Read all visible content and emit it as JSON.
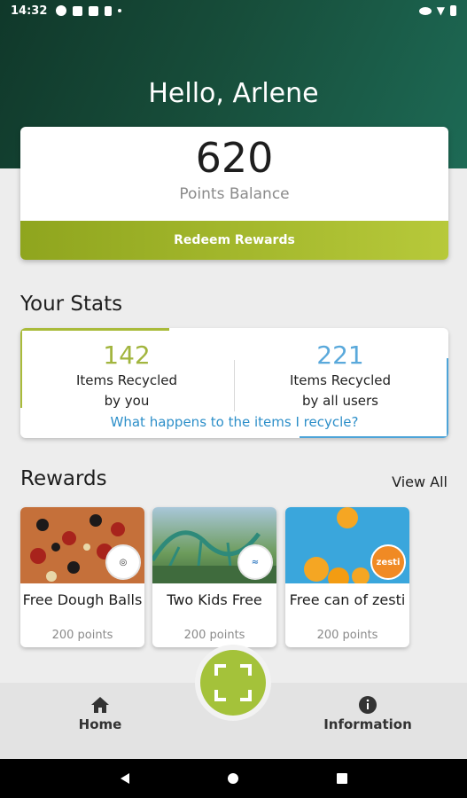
{
  "status_bar": {
    "time": "14:32"
  },
  "header": {
    "greeting": "Hello, Arlene"
  },
  "balance": {
    "points": "620",
    "label": "Points Balance",
    "redeem_label": "Redeem Rewards"
  },
  "stats": {
    "title": "Your Stats",
    "you": {
      "count": "142",
      "label_line1": "Items Recycled",
      "label_line2": "by you"
    },
    "all": {
      "count": "221",
      "label_line1": "Items Recycled",
      "label_line2": "by all users"
    },
    "link": "What happens to the items I recycle?"
  },
  "rewards": {
    "title": "Rewards",
    "view_all": "View All",
    "items": [
      {
        "title": "Free Dough Balls",
        "points": "200 points"
      },
      {
        "title": "Two Kids Free",
        "points": "200 points"
      },
      {
        "title": "Free can of zesti",
        "points": "200 points"
      }
    ]
  },
  "nav": {
    "home": "Home",
    "info": "Information"
  },
  "colors": {
    "accent_green": "#a4c23a",
    "stat_blue": "#5aa9db",
    "header_dark": "#10382a"
  }
}
